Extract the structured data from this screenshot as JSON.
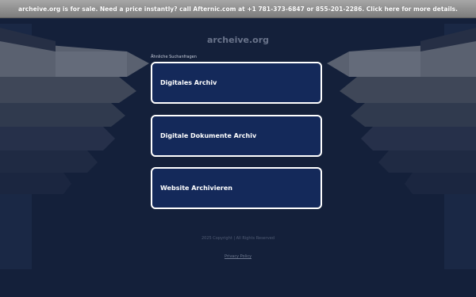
{
  "banner": {
    "text": "archeive.org is for sale. Need a price instantly? call Afternic.com at +1 781-373-6847 or 855-201-2286. Click here for more details."
  },
  "site": {
    "title": "archeive.org"
  },
  "related": {
    "label": "Ähnliche Suchanfragen",
    "links": [
      {
        "label": "Digitales Archiv"
      },
      {
        "label": "Digitale Dokumente Archiv"
      },
      {
        "label": "Website Archivieren"
      }
    ]
  },
  "footer": {
    "copyright": "2025 Copyright | All Rights Reserved",
    "privacy": "Privacy Policy"
  },
  "colors": {
    "background": "#14203a",
    "box_fill": "#14295a",
    "box_border": "#ffffff",
    "banner": "#8f8f8f"
  }
}
